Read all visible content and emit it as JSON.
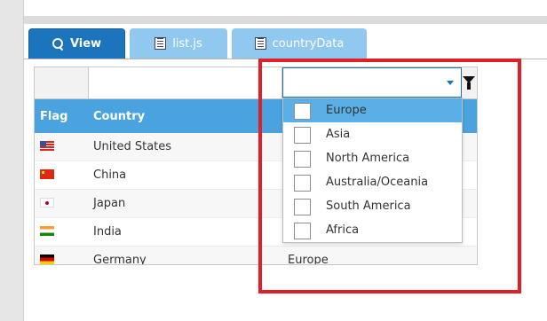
{
  "tabs": [
    {
      "label": "View",
      "active": true,
      "icon": "search-icon"
    },
    {
      "label": "list.js",
      "active": false,
      "icon": "file-icon"
    },
    {
      "label": "countryData",
      "active": false,
      "icon": "file-icon"
    }
  ],
  "grid": {
    "columns": [
      "Flag",
      "Country"
    ],
    "rows": [
      {
        "flag": "us",
        "country": "United States",
        "continent": ""
      },
      {
        "flag": "cn",
        "country": "China",
        "continent": ""
      },
      {
        "flag": "jp",
        "country": "Japan",
        "continent": ""
      },
      {
        "flag": "in",
        "country": "India",
        "continent": ""
      },
      {
        "flag": "de",
        "country": "Germany",
        "continent": "Europe"
      }
    ]
  },
  "filter": {
    "combo_value": "",
    "options": [
      "Europe",
      "Asia",
      "North America",
      "Australia/Oceania",
      "South America",
      "Africa"
    ],
    "highlighted_option": "Europe"
  },
  "colors": {
    "accent": "#1c75bc",
    "header": "#4aa3df",
    "highlight_box": "#e01f26",
    "selected_option": "#5ab0e6"
  }
}
